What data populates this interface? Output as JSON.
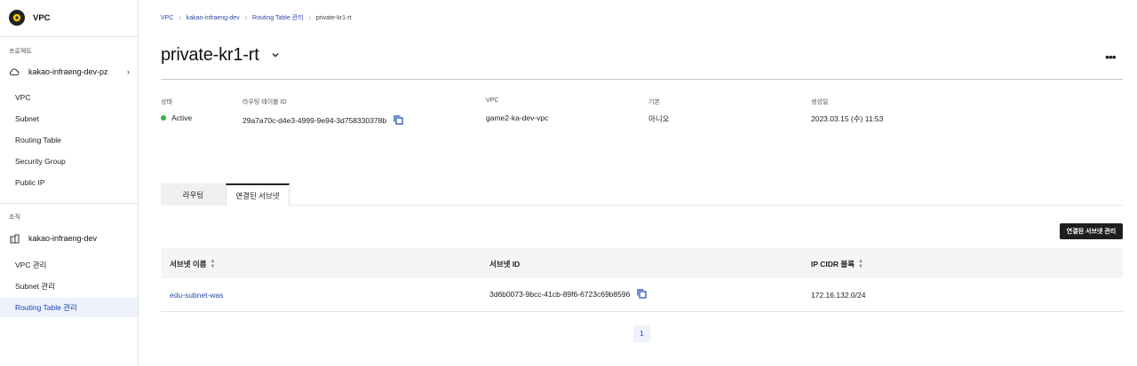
{
  "sidebar": {
    "brand_title": "VPC",
    "project_section_label": "프로젝트",
    "project_name": "kakao-infraeng-dev-pz",
    "project_items": [
      {
        "label": "VPC"
      },
      {
        "label": "Subnet"
      },
      {
        "label": "Routing Table"
      },
      {
        "label": "Security Group"
      },
      {
        "label": "Public IP"
      }
    ],
    "org_section_label": "조직",
    "org_name": "kakao-infraeng-dev",
    "org_items": [
      {
        "label": "VPC 관리"
      },
      {
        "label": "Subnet 관리"
      },
      {
        "label": "Routing Table 관리"
      }
    ]
  },
  "breadcrumb": {
    "items": [
      "VPC",
      "kakao-infraeng-dev",
      "Routing Table 관리"
    ],
    "current": "private-kr1-rt",
    "separator": "›"
  },
  "page": {
    "title": "private-kr1-rt",
    "more_label": "•••"
  },
  "info": {
    "status_label": "상태",
    "status_value": "Active",
    "status_color": "#2fb344",
    "rt_id_label": "라우팅 테이블 ID",
    "rt_id_value": "29a7a70c-d4e3-4999-9e94-3d758330378b",
    "vpc_label": "VPC",
    "vpc_value": "game2-ka-dev-vpc",
    "default_label": "기본",
    "default_value": "아니오",
    "created_label": "생성일",
    "created_value": "2023.03.15 (수) 11:53"
  },
  "tabs": [
    {
      "label": "라우팅",
      "active": false
    },
    {
      "label": "연결된 서브넷",
      "active": true
    }
  ],
  "manage_button_label": "연결된 서브넷 관리",
  "table": {
    "columns": [
      {
        "label": "서브넷 이름",
        "sortable": true
      },
      {
        "label": "서브넷 ID",
        "sortable": false
      },
      {
        "label": "IP CIDR 블록",
        "sortable": true
      }
    ],
    "rows": [
      {
        "name": "edu-subnet-was",
        "id": "3d6b0073-9bcc-41cb-89f6-6723c69b8596",
        "cidr": "172.16.132.0/24"
      }
    ]
  },
  "pagination": {
    "current_page": "1"
  },
  "colors": {
    "accent": "#1a43b8",
    "link": "#2b4aa8",
    "active_nav_bg": "#eef2fb"
  }
}
